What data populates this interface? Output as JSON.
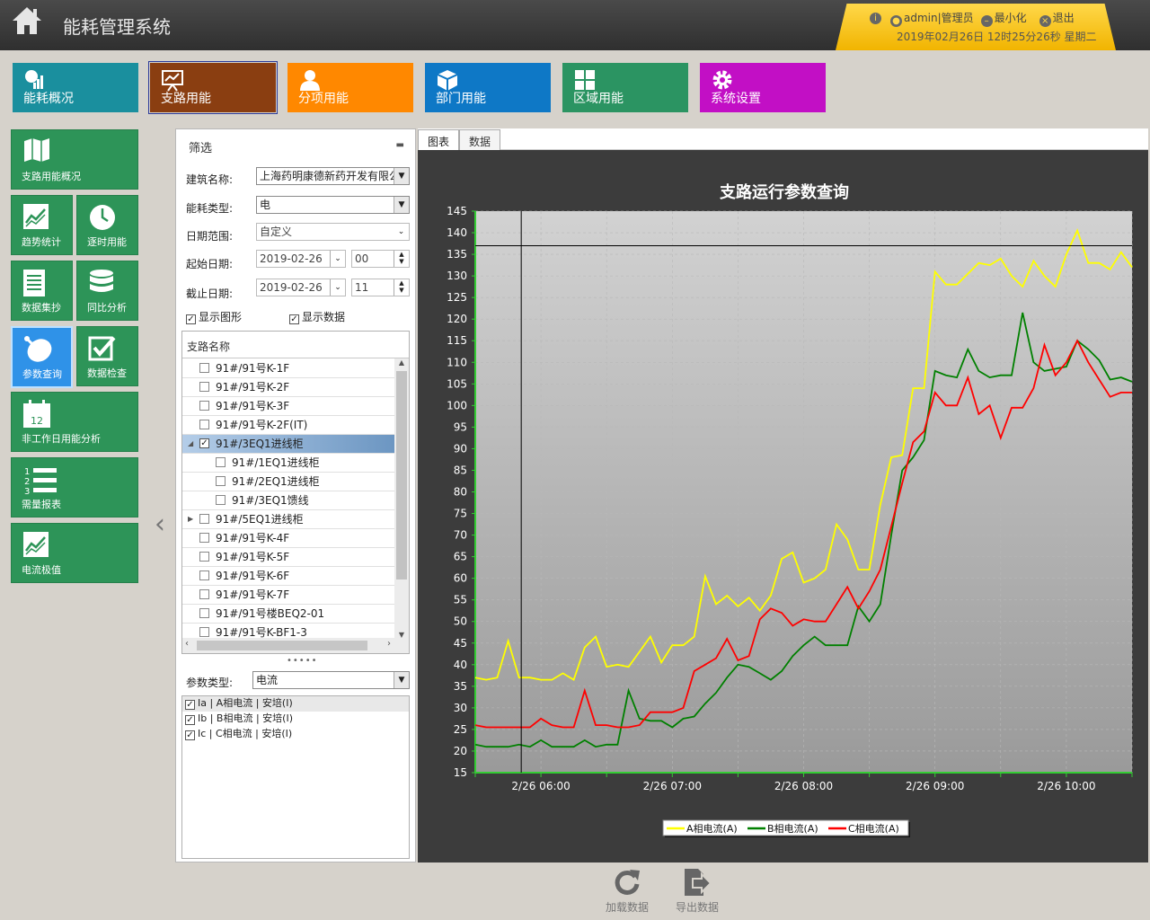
{
  "app": {
    "title": "能耗管理系统",
    "user": "admin|管理员",
    "minimize": "最小化",
    "logout": "退出",
    "datetime": "2019年02月26日 12时25分26秒 星期二"
  },
  "nav": [
    {
      "label": "能耗概况",
      "color": "#1a8f9e",
      "icon": "dashboard-icon"
    },
    {
      "label": "支路用能",
      "color": "#8a3e11",
      "icon": "presentation-chart-icon"
    },
    {
      "label": "分项用能",
      "color": "#ff8800",
      "icon": "person-icon"
    },
    {
      "label": "部门用能",
      "color": "#0e78c6",
      "icon": "cube-icon"
    },
    {
      "label": "区域用能",
      "color": "#2b9462",
      "icon": "grid-icon"
    },
    {
      "label": "系统设置",
      "color": "#c20fc5",
      "icon": "gear-icon"
    }
  ],
  "side": [
    {
      "label": "支路用能概况",
      "icon": "map-icon"
    },
    {
      "label": "趋势统计",
      "icon": "trend-icon"
    },
    {
      "label": "逐时用能",
      "icon": "clock-icon"
    },
    {
      "label": "数据集抄",
      "icon": "document-icon"
    },
    {
      "label": "同比分析",
      "icon": "database-icon"
    },
    {
      "label": "参数查询",
      "icon": "satellite-dish-icon"
    },
    {
      "label": "数据检查",
      "icon": "checkmark-icon"
    },
    {
      "label": "非工作日用能分析",
      "icon": "calendar-icon"
    },
    {
      "label": "需量报表",
      "icon": "numbered-list-icon"
    },
    {
      "label": "电流极值",
      "icon": "trend-icon"
    }
  ],
  "calendar_day": "12",
  "filter": {
    "title": "筛选",
    "building_label": "建筑名称:",
    "building_value": "上海药明康德新药开发有限公",
    "energy_label": "能耗类型:",
    "energy_value": "电",
    "range_label": "日期范围:",
    "range_value": "自定义",
    "start_label": "起始日期:",
    "start_date": "2019-02-26",
    "start_hour": "00",
    "end_label": "截止日期:",
    "end_date": "2019-02-26",
    "end_hour": "11",
    "show_graph": "显示图形",
    "show_data": "显示数据",
    "tree_header": "支路名称",
    "tree": [
      {
        "label": "91#/91号K-1F",
        "checked": false,
        "level": 0
      },
      {
        "label": "91#/91号K-2F",
        "checked": false,
        "level": 0
      },
      {
        "label": "91#/91号K-3F",
        "checked": false,
        "level": 0
      },
      {
        "label": "91#/91号K-2F(IT)",
        "checked": false,
        "level": 0
      },
      {
        "label": "91#/3EQ1进线柜",
        "checked": true,
        "level": 0,
        "expanded": true,
        "selected": true
      },
      {
        "label": "91#/1EQ1进线柜",
        "checked": false,
        "level": 1
      },
      {
        "label": "91#/2EQ1进线柜",
        "checked": false,
        "level": 1
      },
      {
        "label": "91#/3EQ1馈线",
        "checked": false,
        "level": 1
      },
      {
        "label": "91#/5EQ1进线柜",
        "checked": false,
        "level": 0,
        "collapsed": true
      },
      {
        "label": "91#/91号K-4F",
        "checked": false,
        "level": 0
      },
      {
        "label": "91#/91号K-5F",
        "checked": false,
        "level": 0
      },
      {
        "label": "91#/91号K-6F",
        "checked": false,
        "level": 0
      },
      {
        "label": "91#/91号K-7F",
        "checked": false,
        "level": 0
      },
      {
        "label": "91#/91号楼BEQ2-01",
        "checked": false,
        "level": 0
      },
      {
        "label": "91#/91号K-BF1-3",
        "checked": false,
        "level": 0
      }
    ],
    "param_label": "参数类型:",
    "param_value": "电流",
    "params": [
      {
        "label": "Ia | A相电流 | 安培(I)",
        "checked": true
      },
      {
        "label": "Ib | B相电流 | 安培(I)",
        "checked": true
      },
      {
        "label": "Ic | C相电流 | 安培(I)",
        "checked": true
      }
    ]
  },
  "tabs": [
    {
      "label": "图表"
    },
    {
      "label": "数据"
    }
  ],
  "bottom": {
    "reload": "加载数据",
    "export": "导出数据"
  },
  "chart_data": {
    "type": "line",
    "title": "支路运行参数查询",
    "x_start": "2019-02-26 05:30",
    "x_end": "2019-02-26 10:30",
    "x_ticks": [
      "2/26 06:00",
      "2/26 07:00",
      "2/26 08:00",
      "2/26 09:00",
      "2/26 10:00"
    ],
    "ylim": [
      15,
      145
    ],
    "yticks": [
      15,
      20,
      25,
      30,
      35,
      40,
      45,
      50,
      55,
      60,
      65,
      70,
      75,
      80,
      85,
      90,
      95,
      100,
      105,
      110,
      115,
      120,
      125,
      130,
      135,
      140,
      145
    ],
    "grid": true,
    "legend_position": "bottom-center",
    "crosshair": {
      "x": "2019-02-26 05:51",
      "y": 137
    },
    "x": [
      "05:30",
      "05:35",
      "05:40",
      "05:45",
      "05:50",
      "05:55",
      "06:00",
      "06:05",
      "06:10",
      "06:15",
      "06:20",
      "06:25",
      "06:30",
      "06:35",
      "06:40",
      "06:45",
      "06:50",
      "06:55",
      "07:00",
      "07:05",
      "07:10",
      "07:15",
      "07:20",
      "07:25",
      "07:30",
      "07:35",
      "07:40",
      "07:45",
      "07:50",
      "07:55",
      "08:00",
      "08:05",
      "08:10",
      "08:15",
      "08:20",
      "08:25",
      "08:30",
      "08:35",
      "08:40",
      "08:45",
      "08:50",
      "08:55",
      "09:00",
      "09:05",
      "09:10",
      "09:15",
      "09:20",
      "09:25",
      "09:30",
      "09:35",
      "09:40",
      "09:45",
      "09:50",
      "09:55",
      "10:00",
      "10:05",
      "10:10",
      "10:15",
      "10:20",
      "10:25",
      "10:30"
    ],
    "series": [
      {
        "name": "A相电流(A)",
        "color": "#ffff00",
        "values": [
          37,
          36.5,
          37,
          45.5,
          37,
          37,
          36.5,
          36.5,
          38,
          36.5,
          44,
          46.5,
          39.5,
          40,
          39.5,
          43,
          46.5,
          40.5,
          44.5,
          44.5,
          46.5,
          60.5,
          54,
          56,
          53.5,
          55.5,
          52.5,
          56,
          64.5,
          66,
          59,
          60,
          62,
          72.5,
          69,
          62,
          62,
          77,
          88,
          88.5,
          104,
          104,
          131,
          128,
          128,
          130.5,
          133,
          132.5,
          134,
          130,
          127.5,
          133.5,
          130,
          127.5,
          135,
          140.5,
          133,
          133,
          131.5,
          135.5,
          132
        ]
      },
      {
        "name": "B相电流(A)",
        "color": "#008000",
        "values": [
          21.5,
          21,
          21,
          21,
          21.5,
          21,
          22.5,
          21,
          21,
          21,
          22.5,
          21,
          21.5,
          21.5,
          34,
          27.5,
          27,
          27,
          25.5,
          27.5,
          28,
          31,
          33.5,
          37,
          40,
          39.5,
          38,
          36.5,
          38.5,
          42,
          44.5,
          46.5,
          44.5,
          44.5,
          44.5,
          53.5,
          50,
          54,
          70,
          85,
          88,
          92,
          108,
          107,
          106.5,
          113,
          108,
          106.5,
          107,
          107,
          121.5,
          110,
          108,
          108.5,
          109,
          115,
          113,
          110.5,
          106,
          106.5,
          105.5
        ]
      },
      {
        "name": "C相电流(A)",
        "color": "#ff0000",
        "values": [
          26,
          25.5,
          25.5,
          25.5,
          25.5,
          25.5,
          27.5,
          26,
          25.5,
          25.5,
          34,
          26,
          26,
          25.5,
          25.5,
          26,
          29,
          29,
          29,
          30,
          38.5,
          40,
          41.5,
          46,
          41,
          42,
          50.5,
          53,
          52,
          49,
          50.5,
          50,
          50,
          54,
          58,
          53,
          57,
          62,
          72,
          82,
          91.5,
          94,
          103,
          100,
          100,
          106.5,
          98,
          100,
          92.5,
          99.5,
          99.5,
          104,
          114,
          107,
          110,
          115,
          110,
          106,
          102,
          103,
          103
        ]
      }
    ]
  }
}
